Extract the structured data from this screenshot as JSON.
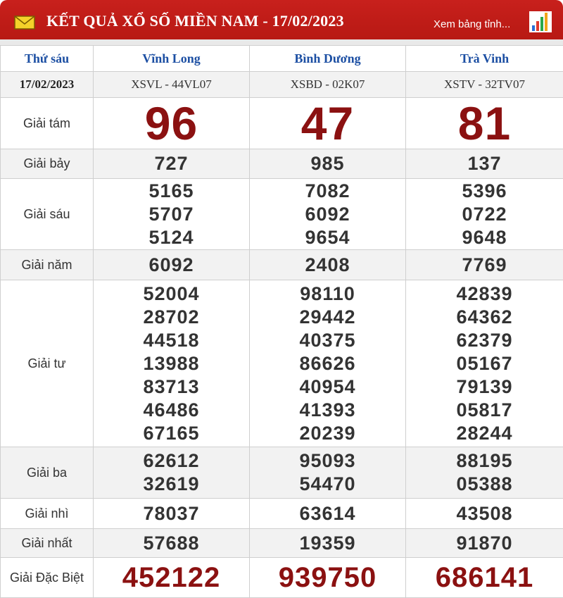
{
  "header": {
    "title": "KẾT QUẢ XỔ SỐ MIỀN NAM - 17/02/2023",
    "view_link": "Xem bảng tỉnh...",
    "icons": {
      "mail": "mail-icon",
      "chart": "bar-chart-icon"
    },
    "colors": {
      "header_bg": "#c8201c",
      "prize_big": "#8b1111",
      "province": "#1c4fa3"
    }
  },
  "columns": {
    "day": "Thứ sáu",
    "date": "17/02/2023",
    "provinces": [
      {
        "name": "Vĩnh Long",
        "code": "XSVL - 44VL07"
      },
      {
        "name": "Bình Dương",
        "code": "XSBD - 02K07"
      },
      {
        "name": "Trà Vinh",
        "code": "XSTV - 32TV07"
      }
    ]
  },
  "prizes": [
    {
      "label": "Giải tám",
      "values": [
        [
          "96"
        ],
        [
          "47"
        ],
        [
          "81"
        ]
      ]
    },
    {
      "label": "Giải bảy",
      "values": [
        [
          "727"
        ],
        [
          "985"
        ],
        [
          "137"
        ]
      ]
    },
    {
      "label": "Giải sáu",
      "values": [
        [
          "5165",
          "5707",
          "5124"
        ],
        [
          "7082",
          "6092",
          "9654"
        ],
        [
          "5396",
          "0722",
          "9648"
        ]
      ]
    },
    {
      "label": "Giải năm",
      "values": [
        [
          "6092"
        ],
        [
          "2408"
        ],
        [
          "7769"
        ]
      ]
    },
    {
      "label": "Giải tư",
      "values": [
        [
          "52004",
          "28702",
          "44518",
          "13988",
          "83713",
          "46486",
          "67165"
        ],
        [
          "98110",
          "29442",
          "40375",
          "86626",
          "40954",
          "41393",
          "20239"
        ],
        [
          "42839",
          "64362",
          "62379",
          "05167",
          "79139",
          "05817",
          "28244"
        ]
      ]
    },
    {
      "label": "Giải ba",
      "values": [
        [
          "62612",
          "32619"
        ],
        [
          "95093",
          "54470"
        ],
        [
          "88195",
          "05388"
        ]
      ]
    },
    {
      "label": "Giải nhì",
      "values": [
        [
          "78037"
        ],
        [
          "63614"
        ],
        [
          "43508"
        ]
      ]
    },
    {
      "label": "Giải nhất",
      "values": [
        [
          "57688"
        ],
        [
          "19359"
        ],
        [
          "91870"
        ]
      ]
    },
    {
      "label": "Giải Đặc Biệt",
      "values": [
        [
          "452122"
        ],
        [
          "939750"
        ],
        [
          "686141"
        ]
      ]
    }
  ]
}
